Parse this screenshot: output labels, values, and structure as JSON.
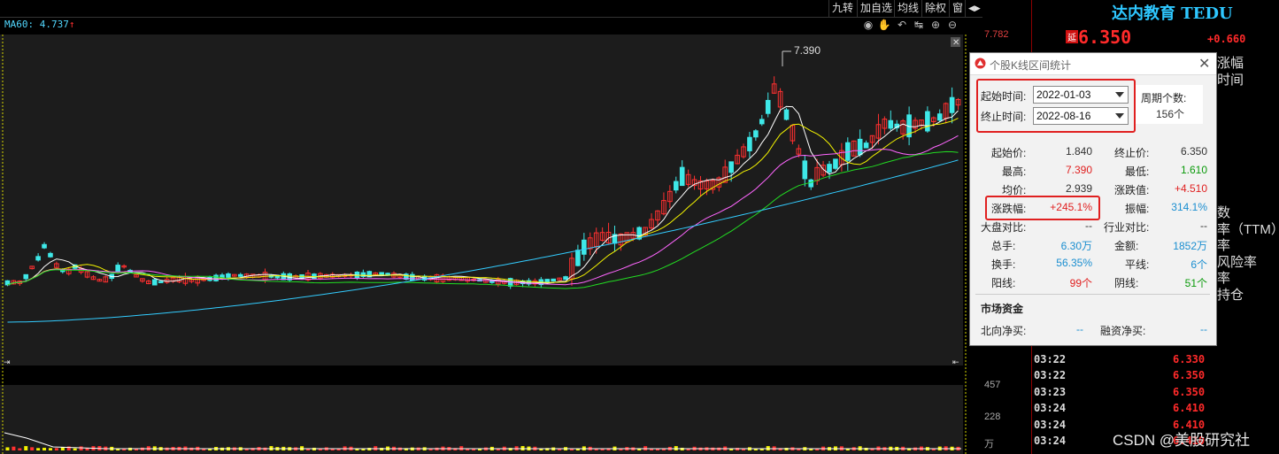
{
  "toolbar": {
    "items": [
      "九转",
      "加自选",
      "均线",
      "除权",
      "窗",
      "◀▶"
    ]
  },
  "indicator": {
    "label": "MA60: 4.737",
    "arrow": "↑"
  },
  "chart": {
    "peak_label": "7.390",
    "axis_top": "7.782",
    "vol_labels": [
      "457",
      "228",
      "万"
    ]
  },
  "quote": {
    "title": "达内教育 TEDU",
    "tag": "延",
    "price": "6.350",
    "change": "+0.660",
    "peek_labels": [
      "涨幅",
      "时间",
      "数",
      "率（TTM）",
      "率",
      "风险率",
      "率",
      "持仓"
    ],
    "ticks": [
      {
        "time": "03:22",
        "price": "6.330"
      },
      {
        "time": "03:22",
        "price": "6.350"
      },
      {
        "time": "03:23",
        "price": "6.350"
      },
      {
        "time": "03:24",
        "price": "6.410"
      },
      {
        "time": "03:24",
        "price": "6.410"
      },
      {
        "time": "03:24",
        "price": "6.410"
      }
    ]
  },
  "dialog": {
    "title": "个股K线区间统计",
    "start_label": "起始时间:",
    "start_value": "2022-01-03",
    "end_label": "终止时间:",
    "end_value": "2022-08-16",
    "period_label": "周期个数:",
    "period_value": "156个",
    "stats": {
      "start_price_label": "起始价:",
      "start_price": "1.840",
      "end_price_label": "终止价:",
      "end_price": "6.350",
      "high_label": "最高:",
      "high": "7.390",
      "low_label": "最低:",
      "low": "1.610",
      "avg_label": "均价:",
      "avg": "2.939",
      "chgval_label": "涨跌值:",
      "chgval": "+4.510",
      "chgpct_label": "涨跌幅:",
      "chgpct": "+245.1%",
      "amp_label": "振幅:",
      "amp": "314.1%",
      "mkt_label": "大盘对比:",
      "mkt": "--",
      "ind_label": "行业对比:",
      "ind": "--",
      "vol_label": "总手:",
      "vol": "6.30万",
      "amt_label": "金额:",
      "amt": "1852万",
      "turn_label": "换手:",
      "turn": "56.35%",
      "flat_label": "平线:",
      "flat": "6个",
      "up_label": "阳线:",
      "up": "99个",
      "down_label": "阴线:",
      "down": "51个"
    },
    "section_title": "市场资金",
    "north_label": "北向净买:",
    "north": "--",
    "margin_label": "融资净买:",
    "margin": "--"
  },
  "watermark": "CSDN @美股研究社",
  "colors": {
    "up_candle": "#ff3030",
    "down_candle": "#3ee8e8",
    "ma_white": "#ffffff",
    "ma_yellow": "#f4f400",
    "ma_pink": "#ff66ff",
    "ma_green": "#22dd22",
    "ma_cyan": "#33ccff"
  }
}
